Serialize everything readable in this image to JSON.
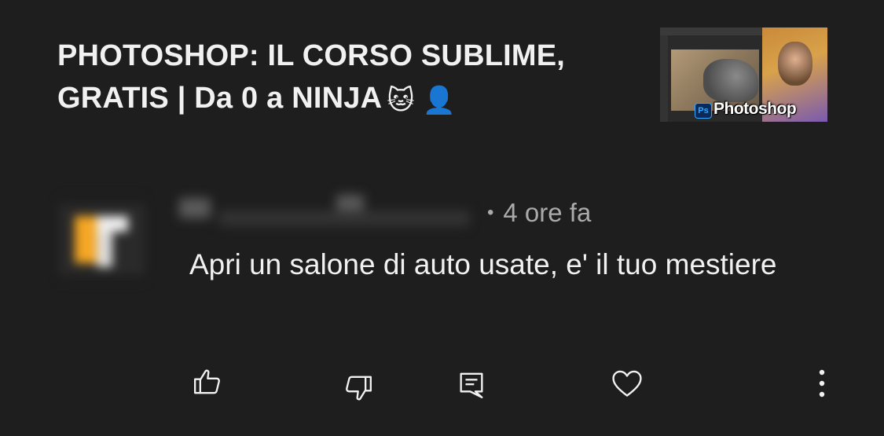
{
  "video": {
    "title": "PHOTOSHOP: IL CORSO SUBLIME, GRATIS | Da 0 a NINJA",
    "emojis": "🐱 👤",
    "thumbnail": {
      "badge": "Ps",
      "label": "Photoshop"
    }
  },
  "comment": {
    "time": "4 ore fa",
    "separator": "•",
    "text": "Apri un salone di auto usate, e' il tuo mestiere"
  },
  "actions": {
    "like": "thumb-up-icon",
    "dislike": "thumb-down-icon",
    "reply": "reply-icon",
    "heart": "heart-icon",
    "more": "more-vertical-icon"
  },
  "colors": {
    "background": "#1e1e1e",
    "text": "#f1f1f1",
    "secondary": "#aaaaaa",
    "photoshop_blue": "#31a8ff"
  }
}
